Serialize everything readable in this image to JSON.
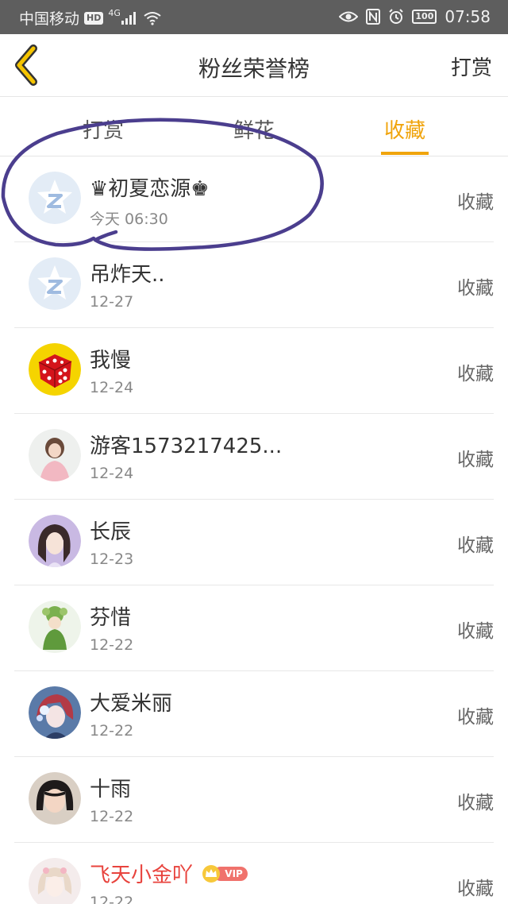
{
  "status_bar": {
    "carrier": "中国移动",
    "hd_badge": "HD",
    "network": "4G",
    "battery": "100",
    "time": "07:58"
  },
  "header": {
    "title": "粉丝荣誉榜",
    "right_action": "打赏"
  },
  "tabs": [
    {
      "label": "打赏",
      "active": false
    },
    {
      "label": "鲜花",
      "active": false
    },
    {
      "label": "收藏",
      "active": true
    }
  ],
  "colors": {
    "accent": "#f0a40c",
    "vip_name": "#e8433d",
    "annotation": "#4b3e8e"
  },
  "list": [
    {
      "name": "♛初夏恋源♚",
      "date": "今天 06:30",
      "action": "收藏",
      "avatar": "default-z-avatar"
    },
    {
      "name": "吊炸天..",
      "date": "12-27",
      "action": "收藏",
      "avatar": "default-z-avatar"
    },
    {
      "name": "我慢",
      "date": "12-24",
      "action": "收藏",
      "avatar": "red-dice-avatar"
    },
    {
      "name": "游客1573217425...",
      "date": "12-24",
      "action": "收藏",
      "avatar": "girl-photo-avatar"
    },
    {
      "name": "长辰",
      "date": "12-23",
      "action": "收藏",
      "avatar": "anime-girl-avatar"
    },
    {
      "name": "芬惜",
      "date": "12-22",
      "action": "收藏",
      "avatar": "green-character-avatar"
    },
    {
      "name": "大爱米丽",
      "date": "12-22",
      "action": "收藏",
      "avatar": "blue-anime-avatar"
    },
    {
      "name": "十雨",
      "date": "12-22",
      "action": "收藏",
      "avatar": "child-photo-avatar"
    },
    {
      "name": "飞天小金吖",
      "date": "12-22",
      "action": "收藏",
      "avatar": "pink-anime-avatar",
      "vip": "VIP"
    }
  ]
}
